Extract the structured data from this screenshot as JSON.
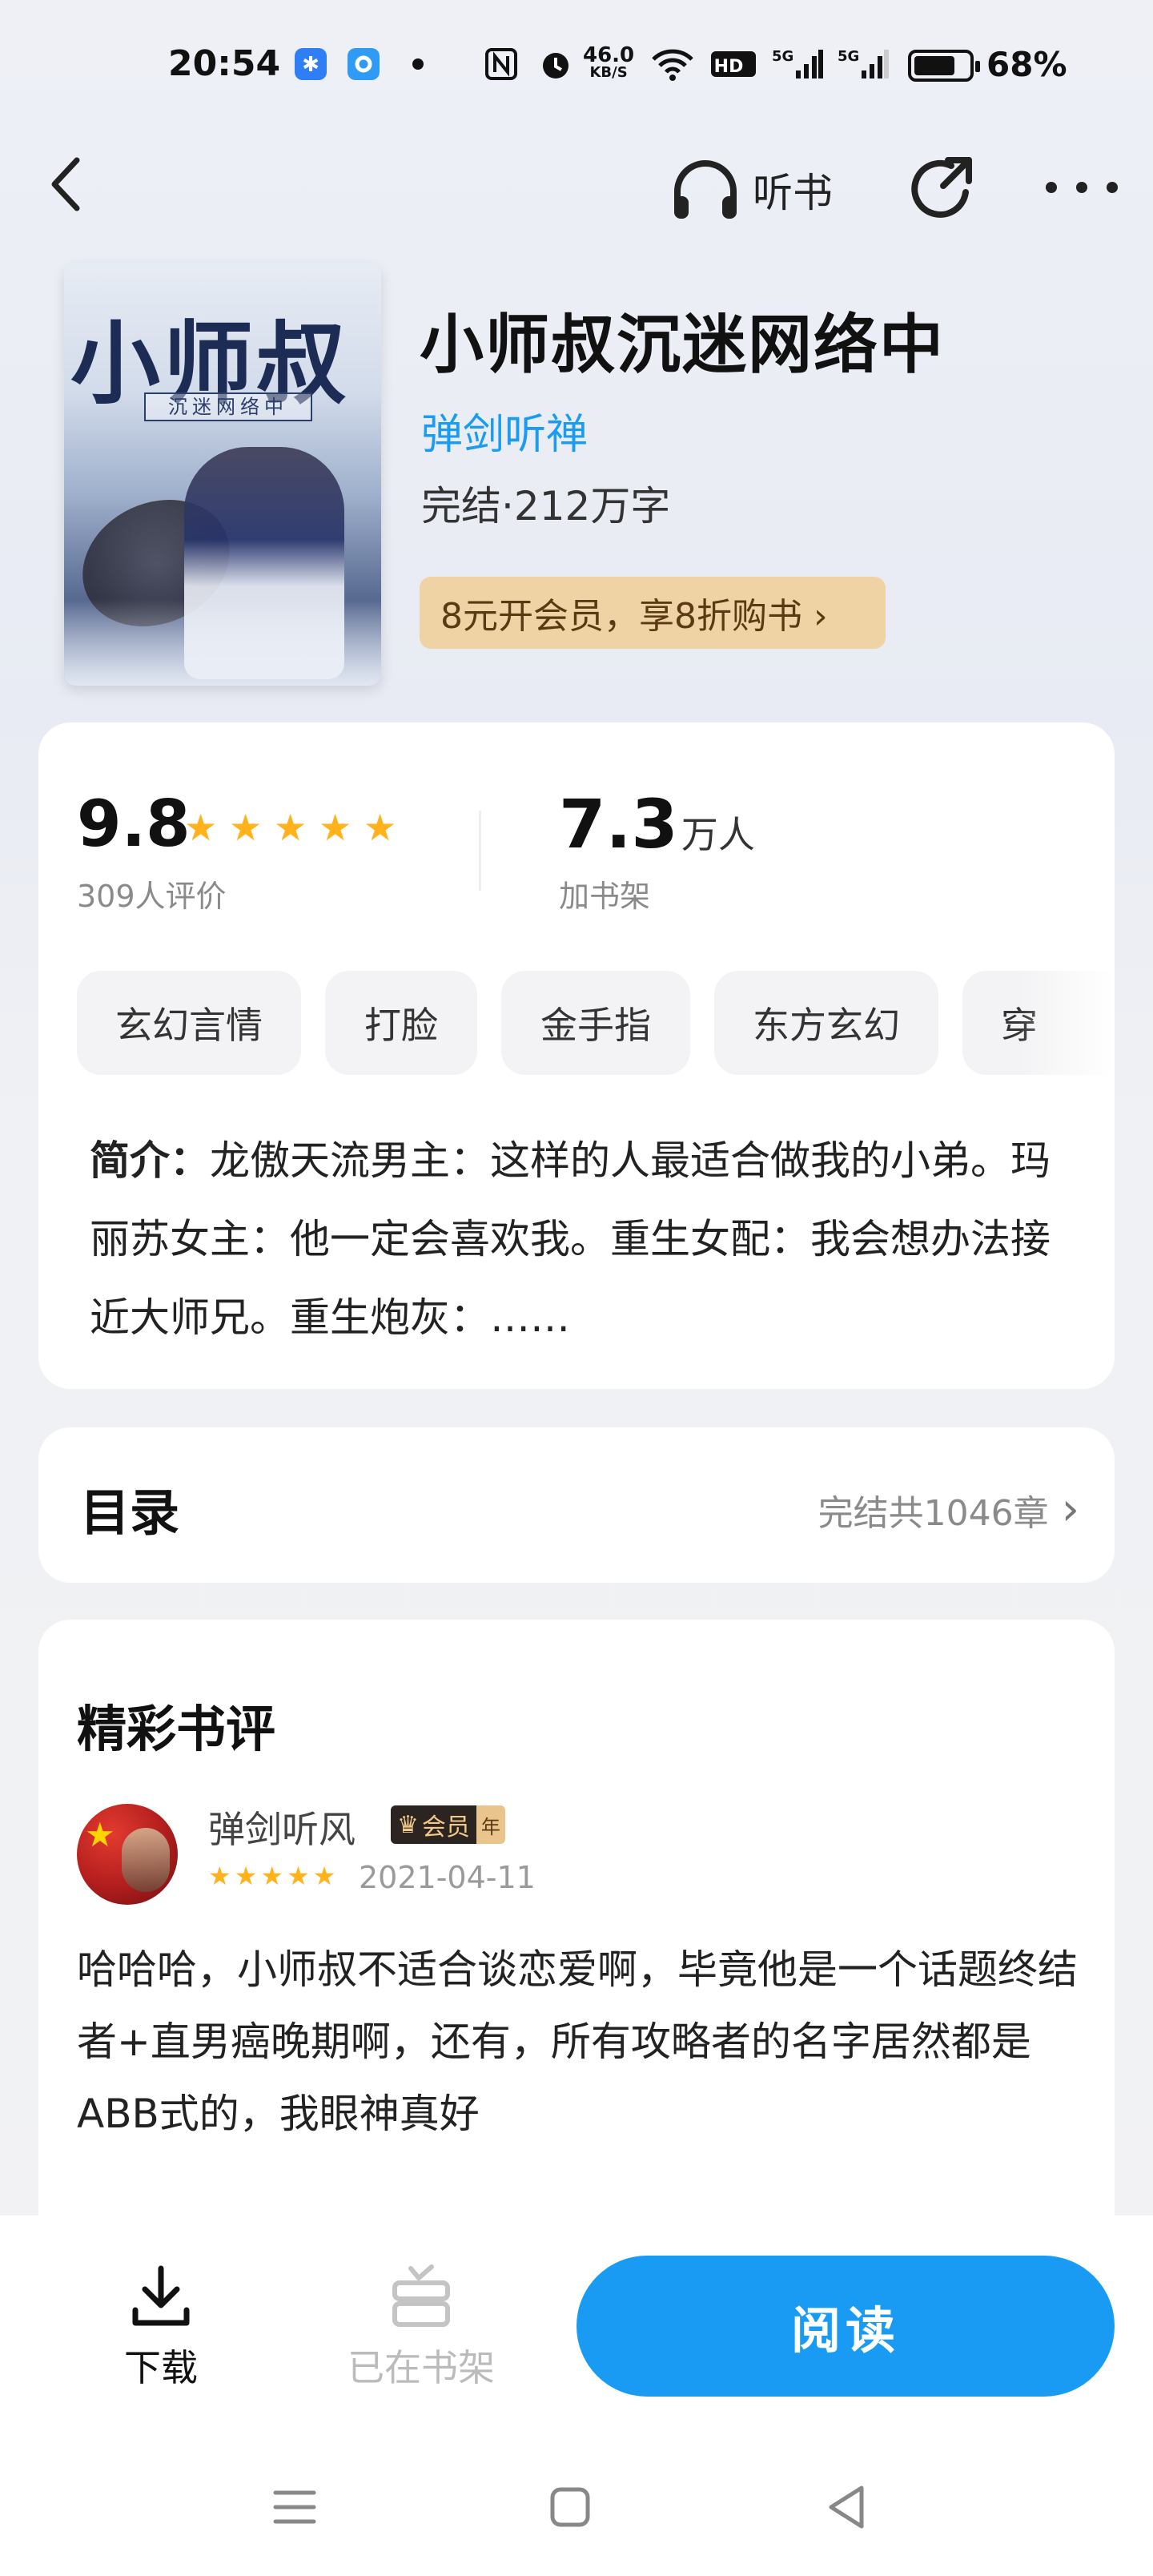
{
  "status_bar": {
    "time": "20:54",
    "net_speed_top": "46.0",
    "net_speed_unit": "KB/S",
    "hd_label": "HD",
    "sig1": "5G",
    "sig2": "5G",
    "battery_pct": "68%",
    "battery_level": 0.68
  },
  "nav": {
    "listen_label": "听书"
  },
  "book": {
    "title": "小师叔沉迷网络中",
    "author": "弹剑听禅",
    "meta": "完结·212万字",
    "vip_promo": "8元开会员，享8折购书 ›",
    "cover": {
      "title_art": "小师叔",
      "subtitle_art": "沉迷网络中"
    }
  },
  "stats": {
    "score": "9.8",
    "star_rating": 5,
    "ratings_count_label": "309人评价",
    "shelf_num": "7.3",
    "shelf_unit": "万人",
    "shelf_label": "加书架"
  },
  "tags": [
    "玄幻言情",
    "打脸",
    "金手指",
    "东方玄幻",
    "穿"
  ],
  "intro": {
    "label": "简介：",
    "text": "龙傲天流男主：这样的人最适合做我的小弟。玛丽苏女主：他一定会喜欢我。重生女配：我会想办法接近大师兄。重生炮灰：……"
  },
  "toc": {
    "title": "目录",
    "summary": "完结共1046章",
    "chevron": "›"
  },
  "reviews": {
    "heading": "精彩书评",
    "items": [
      {
        "user": "弹剑听风",
        "badge_main": "会员",
        "badge_sub": "年",
        "stars": 5,
        "date": "2021-04-11",
        "text": "哈哈哈，小师叔不适合谈恋爱啊，毕竟他是一个话题终结者+直男癌晚期啊，还有，所有攻略者的名字居然都是ABB式的，我眼神真好"
      }
    ]
  },
  "bottom": {
    "download_label": "下载",
    "shelf_label": "已在书架",
    "read_label": "阅读"
  },
  "colors": {
    "accent_blue": "#1a9bf3",
    "star_gold": "#ffb21a",
    "promo_bg": "#efd3a5"
  }
}
